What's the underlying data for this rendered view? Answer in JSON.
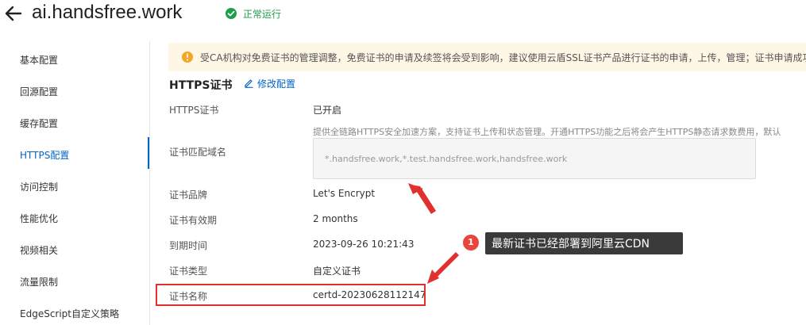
{
  "header": {
    "title": "ai.handsfree.work",
    "status": "正常运行",
    "status_color": "#1e9e4a"
  },
  "sidebar": {
    "items": [
      {
        "label": "基本配置",
        "active": false
      },
      {
        "label": "回源配置",
        "active": false
      },
      {
        "label": "缓存配置",
        "active": false
      },
      {
        "label": "HTTPS配置",
        "active": true
      },
      {
        "label": "访问控制",
        "active": false
      },
      {
        "label": "性能优化",
        "active": false
      },
      {
        "label": "视频相关",
        "active": false
      },
      {
        "label": "流量限制",
        "active": false
      },
      {
        "label": "EdgeScript自定义策略",
        "active": false
      }
    ],
    "accent_color": "#0064c8"
  },
  "notice": {
    "text": "受CA机构对免费证书的管理调整，免费证书的申请及续签将会受到影响，建议使用云盾SSL证书产品进行证书的申请，上传，管理；证书申请成功"
  },
  "section": {
    "title": "HTTPS证书",
    "edit_label": "修改配置"
  },
  "fields": {
    "https_label": "HTTPS证书",
    "https_value": "已开启",
    "https_desc": "提供全链路HTTPS安全加速方案，支持证书上传和状态管理。开通HTTPS功能之后将会产生HTTPS静态请求数费用，默认",
    "domains_label": "证书匹配域名",
    "domains_value": "*.handsfree.work,*.test.handsfree.work,handsfree.work",
    "brand_label": "证书品牌",
    "brand_value": "Let's Encrypt",
    "validity_label": "证书有效期",
    "validity_value": "2 months",
    "expiry_label": "到期时间",
    "expiry_value": "2023-09-26 10:21:43",
    "type_label": "证书类型",
    "type_value": "自定义证书",
    "name_label": "证书名称",
    "name_value": "certd-20230628112147"
  },
  "annotation": {
    "badge": "1",
    "tooltip": "最新证书已经部署到阿里云CDN",
    "arrow_color": "#e03030"
  }
}
